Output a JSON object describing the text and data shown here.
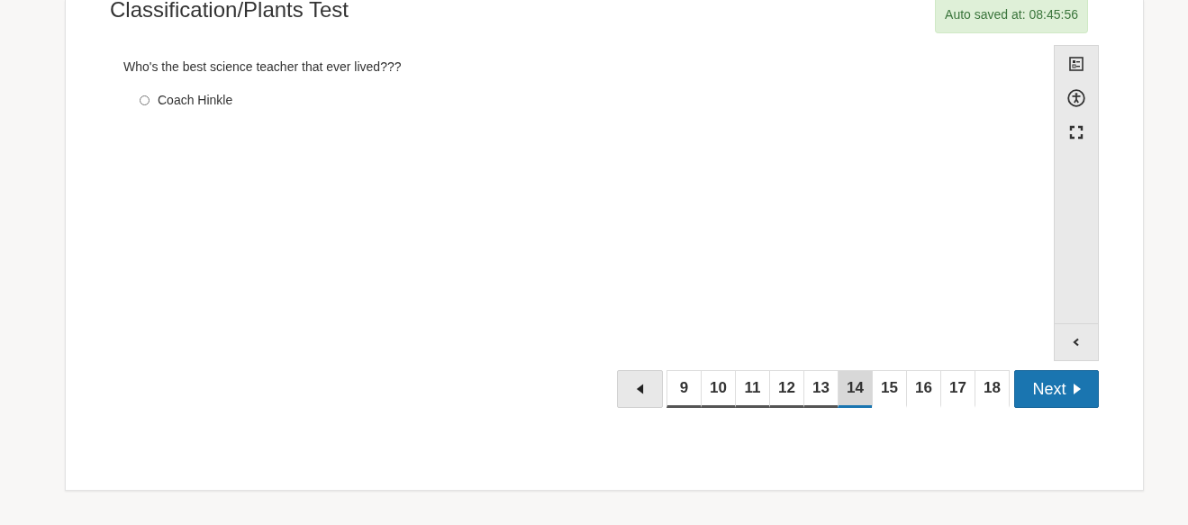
{
  "test_title": "Classification/Plants Test",
  "autosave": "Auto saved at: 08:45:56",
  "question": {
    "text": "Who's the best science teacher that ever lived???",
    "options": [
      {
        "label": "Coach Hinkle",
        "selected": false
      }
    ]
  },
  "pages": [
    {
      "label": "9",
      "selected": false,
      "answered": true
    },
    {
      "label": "10",
      "selected": false,
      "answered": true
    },
    {
      "label": "11",
      "selected": false,
      "answered": true
    },
    {
      "label": "12",
      "selected": false,
      "answered": true
    },
    {
      "label": "13",
      "selected": false,
      "answered": true
    },
    {
      "label": "14",
      "selected": true,
      "answered": false
    },
    {
      "label": "15",
      "selected": false,
      "answered": false
    },
    {
      "label": "16",
      "selected": false,
      "answered": false
    },
    {
      "label": "17",
      "selected": false,
      "answered": false
    },
    {
      "label": "18",
      "selected": false,
      "answered": false
    }
  ],
  "next_button": "Next"
}
